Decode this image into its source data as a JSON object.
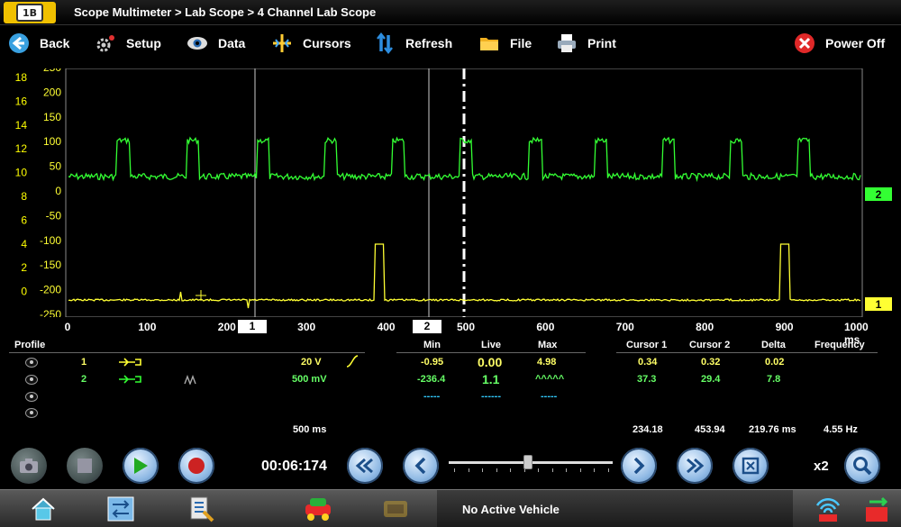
{
  "title": {
    "logo_text": "1B",
    "breadcrumb": "Scope Multimeter > Lab Scope > 4 Channel Lab Scope"
  },
  "toolbar": {
    "back": "Back",
    "setup": "Setup",
    "data": "Data",
    "cursors": "Cursors",
    "refresh": "Refresh",
    "file": "File",
    "print": "Print",
    "power_off": "Power Off"
  },
  "graph": {
    "left_axis_yellow": [
      "18",
      "16",
      "14",
      "12",
      "10",
      "8",
      "6",
      "4",
      "2",
      "0"
    ],
    "left_axis_white": [
      "250",
      "200",
      "150",
      "100",
      "50",
      "0",
      "-50",
      "-100",
      "-150",
      "-200",
      "-250"
    ],
    "channel_markers": [
      "2",
      "1"
    ],
    "colors": {
      "ch1": "#ffff00",
      "ch2": "#33ff33",
      "cursor": "#ffffff"
    }
  },
  "xaxis": {
    "ticks": [
      "0",
      "100",
      "200",
      "300",
      "400",
      "500",
      "600",
      "700",
      "800",
      "900",
      "1000 ms"
    ],
    "cursor1_label": "1",
    "cursor2_label": "2"
  },
  "panel": {
    "profile_header": "Profile",
    "headers": {
      "min": "Min",
      "live": "Live",
      "max": "Max",
      "cursor1": "Cursor 1",
      "cursor2": "Cursor 2",
      "delta": "Delta",
      "frequency": "Frequency"
    },
    "rows": [
      {
        "channel": "1",
        "scale": "20 V",
        "min": "-0.95",
        "live": "0.00",
        "max": "4.98",
        "cursor1": "0.34",
        "cursor2": "0.32",
        "delta": "0.02"
      },
      {
        "channel": "2",
        "scale": "500 mV",
        "min": "-236.4",
        "live": "1.1",
        "max": "^^^^^",
        "cursor1": "37.3",
        "cursor2": "29.4",
        "delta": "7.8"
      },
      {
        "min": "-----",
        "live": "------",
        "max": "-----"
      }
    ],
    "timebase": "500 ms",
    "cursor1_time": "234.18",
    "cursor2_time": "453.94",
    "delta_time": "219.76 ms",
    "frequency": "4.55 Hz"
  },
  "controls": {
    "timer": "00:06:174",
    "zoom": "x2",
    "slider_position": 0.48
  },
  "taskbar": {
    "vehicle_status": "No Active Vehicle"
  }
}
